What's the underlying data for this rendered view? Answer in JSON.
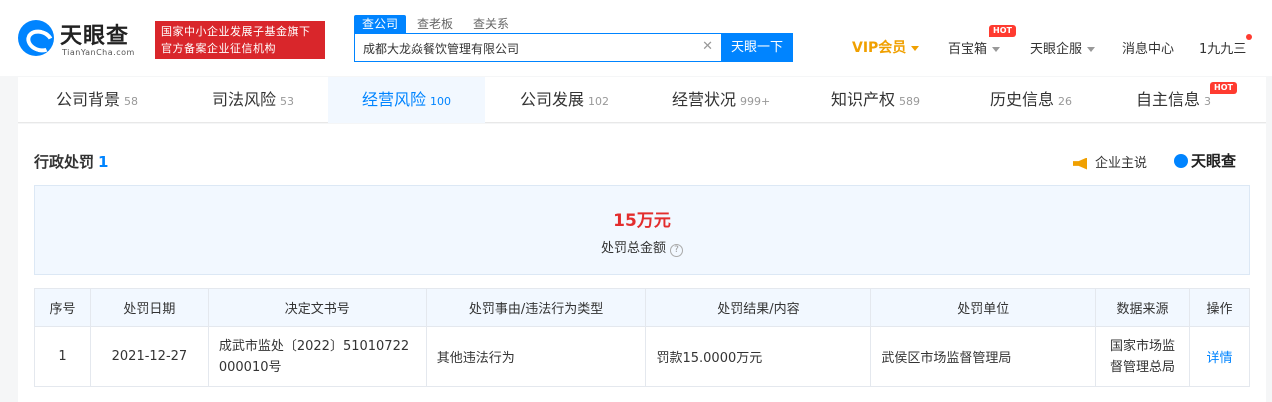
{
  "header": {
    "logo_text": "天眼查",
    "logo_sub": "TianYanCha.com",
    "badge_line1": "国家中小企业发展子基金旗下",
    "badge_line2": "官方备案企业征信机构",
    "search_tabs": [
      "查公司",
      "查老板",
      "查关系"
    ],
    "search_value": "成都大龙焱餐饮管理有限公司",
    "search_button": "天眼一下",
    "vip": "VIP会员",
    "nav": [
      "百宝箱",
      "天眼企服",
      "消息中心",
      "1九九三"
    ],
    "hot": "HOT"
  },
  "tabs": [
    {
      "label": "公司背景",
      "count": "58"
    },
    {
      "label": "司法风险",
      "count": "53"
    },
    {
      "label": "经营风险",
      "count": "100"
    },
    {
      "label": "公司发展",
      "count": "102"
    },
    {
      "label": "经营状况",
      "count": "999+"
    },
    {
      "label": "知识产权",
      "count": "589"
    },
    {
      "label": "历史信息",
      "count": "26"
    },
    {
      "label": "自主信息",
      "count": "3"
    }
  ],
  "section": {
    "title": "行政处罚",
    "count": "1",
    "enterprise_say": "企业主说",
    "brand": "天眼查"
  },
  "summary": {
    "amount": "15万元",
    "label": "处罚总金额",
    "help": "?"
  },
  "table": {
    "headers": [
      "序号",
      "处罚日期",
      "决定文书号",
      "处罚事由/违法行为类型",
      "处罚结果/内容",
      "处罚单位",
      "数据来源",
      "操作"
    ],
    "rows": [
      {
        "index": "1",
        "date": "2021-12-27",
        "doc_line1": "成武市监处〔2022〕51010722",
        "doc_line2": "000010号",
        "reason": "其他违法行为",
        "result": "罚款15.0000万元",
        "unit": "武侯区市场监督管理局",
        "source_line1": "国家市场监",
        "source_line2": "督管理总局",
        "action": "详情"
      }
    ]
  },
  "colors": {
    "accent": "#0084ff",
    "vip": "#f0a000",
    "amount": "#e32d2d",
    "badge": "#d9262b"
  }
}
